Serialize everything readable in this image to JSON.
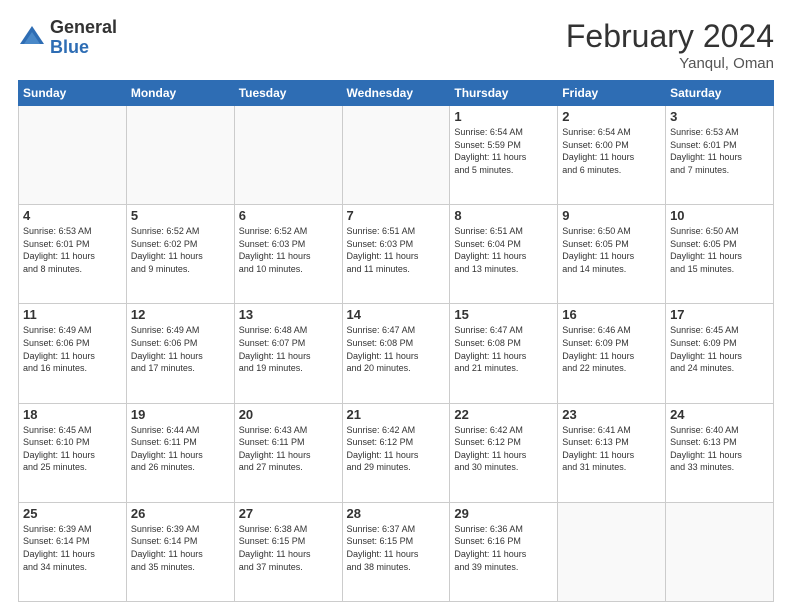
{
  "header": {
    "logo_general": "General",
    "logo_blue": "Blue",
    "month_title": "February 2024",
    "subtitle": "Yanqul, Oman"
  },
  "days_of_week": [
    "Sunday",
    "Monday",
    "Tuesday",
    "Wednesday",
    "Thursday",
    "Friday",
    "Saturday"
  ],
  "weeks": [
    [
      {
        "day": "",
        "info": ""
      },
      {
        "day": "",
        "info": ""
      },
      {
        "day": "",
        "info": ""
      },
      {
        "day": "",
        "info": ""
      },
      {
        "day": "1",
        "info": "Sunrise: 6:54 AM\nSunset: 5:59 PM\nDaylight: 11 hours\nand 5 minutes."
      },
      {
        "day": "2",
        "info": "Sunrise: 6:54 AM\nSunset: 6:00 PM\nDaylight: 11 hours\nand 6 minutes."
      },
      {
        "day": "3",
        "info": "Sunrise: 6:53 AM\nSunset: 6:01 PM\nDaylight: 11 hours\nand 7 minutes."
      }
    ],
    [
      {
        "day": "4",
        "info": "Sunrise: 6:53 AM\nSunset: 6:01 PM\nDaylight: 11 hours\nand 8 minutes."
      },
      {
        "day": "5",
        "info": "Sunrise: 6:52 AM\nSunset: 6:02 PM\nDaylight: 11 hours\nand 9 minutes."
      },
      {
        "day": "6",
        "info": "Sunrise: 6:52 AM\nSunset: 6:03 PM\nDaylight: 11 hours\nand 10 minutes."
      },
      {
        "day": "7",
        "info": "Sunrise: 6:51 AM\nSunset: 6:03 PM\nDaylight: 11 hours\nand 11 minutes."
      },
      {
        "day": "8",
        "info": "Sunrise: 6:51 AM\nSunset: 6:04 PM\nDaylight: 11 hours\nand 13 minutes."
      },
      {
        "day": "9",
        "info": "Sunrise: 6:50 AM\nSunset: 6:05 PM\nDaylight: 11 hours\nand 14 minutes."
      },
      {
        "day": "10",
        "info": "Sunrise: 6:50 AM\nSunset: 6:05 PM\nDaylight: 11 hours\nand 15 minutes."
      }
    ],
    [
      {
        "day": "11",
        "info": "Sunrise: 6:49 AM\nSunset: 6:06 PM\nDaylight: 11 hours\nand 16 minutes."
      },
      {
        "day": "12",
        "info": "Sunrise: 6:49 AM\nSunset: 6:06 PM\nDaylight: 11 hours\nand 17 minutes."
      },
      {
        "day": "13",
        "info": "Sunrise: 6:48 AM\nSunset: 6:07 PM\nDaylight: 11 hours\nand 19 minutes."
      },
      {
        "day": "14",
        "info": "Sunrise: 6:47 AM\nSunset: 6:08 PM\nDaylight: 11 hours\nand 20 minutes."
      },
      {
        "day": "15",
        "info": "Sunrise: 6:47 AM\nSunset: 6:08 PM\nDaylight: 11 hours\nand 21 minutes."
      },
      {
        "day": "16",
        "info": "Sunrise: 6:46 AM\nSunset: 6:09 PM\nDaylight: 11 hours\nand 22 minutes."
      },
      {
        "day": "17",
        "info": "Sunrise: 6:45 AM\nSunset: 6:09 PM\nDaylight: 11 hours\nand 24 minutes."
      }
    ],
    [
      {
        "day": "18",
        "info": "Sunrise: 6:45 AM\nSunset: 6:10 PM\nDaylight: 11 hours\nand 25 minutes."
      },
      {
        "day": "19",
        "info": "Sunrise: 6:44 AM\nSunset: 6:11 PM\nDaylight: 11 hours\nand 26 minutes."
      },
      {
        "day": "20",
        "info": "Sunrise: 6:43 AM\nSunset: 6:11 PM\nDaylight: 11 hours\nand 27 minutes."
      },
      {
        "day": "21",
        "info": "Sunrise: 6:42 AM\nSunset: 6:12 PM\nDaylight: 11 hours\nand 29 minutes."
      },
      {
        "day": "22",
        "info": "Sunrise: 6:42 AM\nSunset: 6:12 PM\nDaylight: 11 hours\nand 30 minutes."
      },
      {
        "day": "23",
        "info": "Sunrise: 6:41 AM\nSunset: 6:13 PM\nDaylight: 11 hours\nand 31 minutes."
      },
      {
        "day": "24",
        "info": "Sunrise: 6:40 AM\nSunset: 6:13 PM\nDaylight: 11 hours\nand 33 minutes."
      }
    ],
    [
      {
        "day": "25",
        "info": "Sunrise: 6:39 AM\nSunset: 6:14 PM\nDaylight: 11 hours\nand 34 minutes."
      },
      {
        "day": "26",
        "info": "Sunrise: 6:39 AM\nSunset: 6:14 PM\nDaylight: 11 hours\nand 35 minutes."
      },
      {
        "day": "27",
        "info": "Sunrise: 6:38 AM\nSunset: 6:15 PM\nDaylight: 11 hours\nand 37 minutes."
      },
      {
        "day": "28",
        "info": "Sunrise: 6:37 AM\nSunset: 6:15 PM\nDaylight: 11 hours\nand 38 minutes."
      },
      {
        "day": "29",
        "info": "Sunrise: 6:36 AM\nSunset: 6:16 PM\nDaylight: 11 hours\nand 39 minutes."
      },
      {
        "day": "",
        "info": ""
      },
      {
        "day": "",
        "info": ""
      }
    ]
  ]
}
